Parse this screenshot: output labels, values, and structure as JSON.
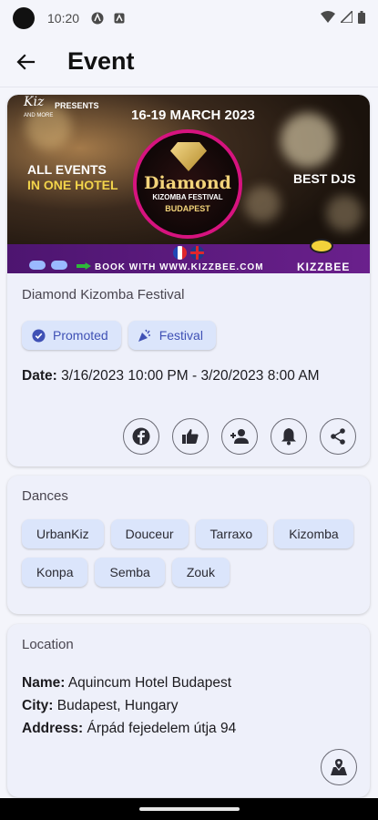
{
  "status_bar": {
    "time": "10:20",
    "left_icons": [
      "android-icon",
      "a-square-icon"
    ],
    "right_icons": [
      "wifi-icon",
      "signal-icon",
      "battery-icon"
    ]
  },
  "app_bar": {
    "title": "Event",
    "back_icon": "arrow-left-icon"
  },
  "banner": {
    "presents": "PRESENTS",
    "logo_text": "Kiz",
    "logo_sub": "AND MORE",
    "date": "16-19 MARCH 2023",
    "diamond": "Diamond",
    "festival": "KIZOMBA FESTIVAL",
    "city": "BUDAPEST",
    "all_events_1": "ALL EVENTS",
    "all_events_2": "IN ONE HOTEL",
    "best_djs": "BEST DJS",
    "book": "BOOK WITH WWW.KIZZBEE.COM",
    "brand": "KIZZBEE"
  },
  "event": {
    "name": "Diamond Kizomba Festival",
    "chips": [
      {
        "label": "Promoted",
        "icon": "verified-badge-icon"
      },
      {
        "label": "Festival",
        "icon": "party-popper-icon"
      }
    ],
    "date_label": "Date:",
    "date_value": " 3/16/2023 10:00 PM - 3/20/2023 8:00 AM",
    "actions": [
      "facebook-icon",
      "thumb-up-icon",
      "person-add-icon",
      "bell-icon",
      "share-icon"
    ]
  },
  "dances": {
    "label": "Dances",
    "items": [
      "UrbanKiz",
      "Douceur",
      "Tarraxo",
      "Kizomba",
      "Konpa",
      "Semba",
      "Zouk"
    ]
  },
  "location": {
    "label": "Location",
    "name_label": "Name:",
    "name_value": " Aquincum Hotel Budapest",
    "city_label": "City:",
    "city_value": " Budapest, Hungary",
    "address_label": "Address:",
    "address_value": " Árpád fejedelem útja 94",
    "map_icon": "map-icon"
  },
  "colors": {
    "background": "#f4f5fb",
    "card": "#eef0fa",
    "chip": "#dbe5fb",
    "chip_text": "#3f51b5",
    "banner_accent": "#d6137f"
  }
}
